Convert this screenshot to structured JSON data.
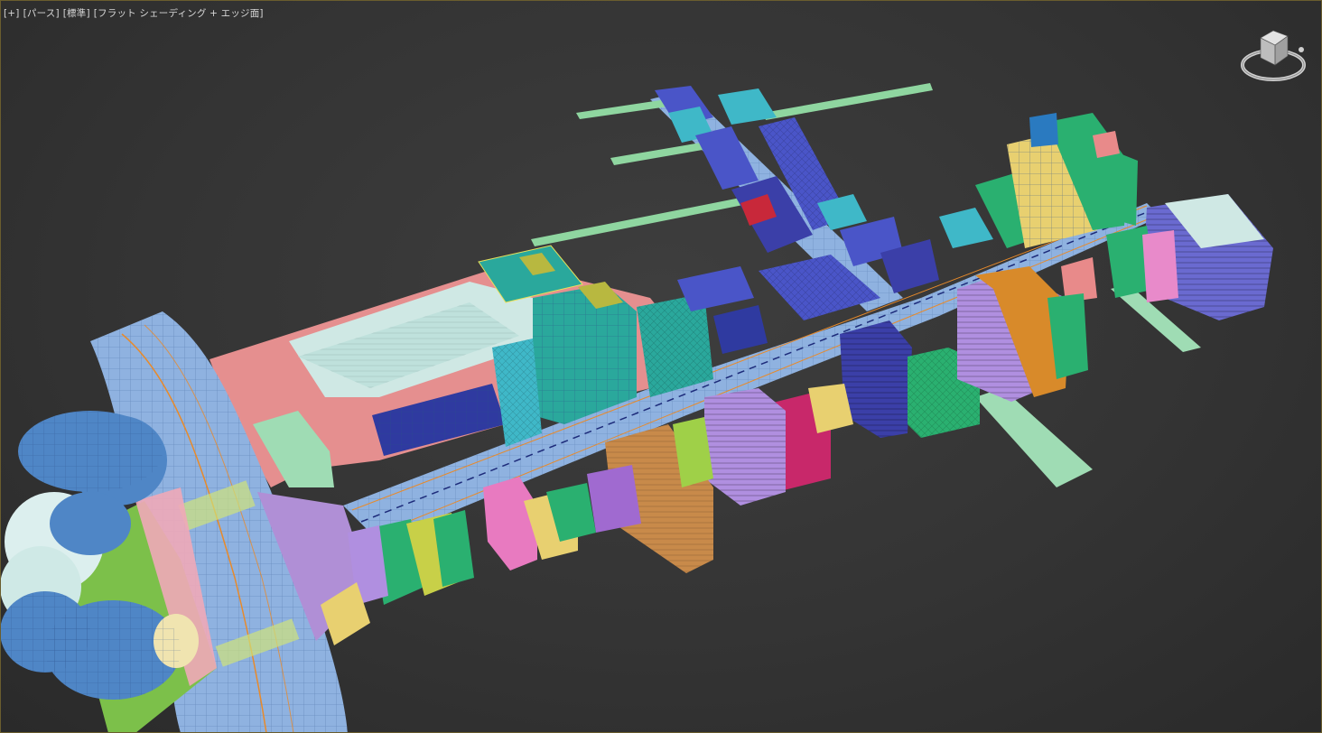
{
  "viewport": {
    "label_plus": "[+]",
    "label_view": "[パース]",
    "label_camera": "[標準]",
    "label_shading": "[フラット シェーディング + エッジ面]"
  },
  "icons": {
    "viewcube": "viewcube-icon",
    "plus_menu": "plus-menu-icon"
  },
  "colors": {
    "background": "#3a3a3a",
    "border_accent": "#6a5d2e",
    "road": "#8fb2e0",
    "ground_pink": "#e58f8f",
    "tree": "#4f86c6",
    "tree_light": "#cfe9e6"
  }
}
